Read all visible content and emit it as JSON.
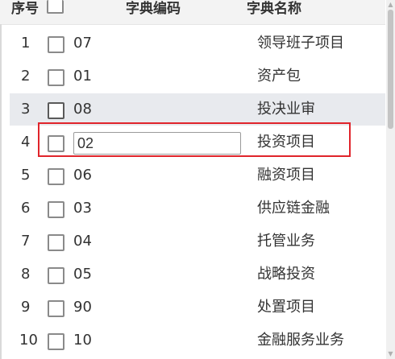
{
  "header": {
    "index_label": "序号",
    "code_label": "字典编码",
    "name_label": "字典名称"
  },
  "rows": [
    {
      "index": "1",
      "code": "07",
      "name": "领导班子项目",
      "highlighted": false,
      "editing": false
    },
    {
      "index": "2",
      "code": "01",
      "name": "资产包",
      "highlighted": false,
      "editing": false
    },
    {
      "index": "3",
      "code": "08",
      "name": "投决业审",
      "highlighted": true,
      "editing": false
    },
    {
      "index": "4",
      "code": "02",
      "name": "投资项目",
      "highlighted": false,
      "editing": true
    },
    {
      "index": "5",
      "code": "06",
      "name": "融资项目",
      "highlighted": false,
      "editing": false
    },
    {
      "index": "6",
      "code": "03",
      "name": "供应链金融",
      "highlighted": false,
      "editing": false
    },
    {
      "index": "7",
      "code": "04",
      "name": "托管业务",
      "highlighted": false,
      "editing": false
    },
    {
      "index": "8",
      "code": "05",
      "name": "战略投资",
      "highlighted": false,
      "editing": false
    },
    {
      "index": "9",
      "code": "90",
      "name": "处置项目",
      "highlighted": false,
      "editing": false
    },
    {
      "index": "10",
      "code": "10",
      "name": "金融服务业务",
      "highlighted": false,
      "editing": false
    }
  ],
  "colors": {
    "selection_outline": "#e0242b",
    "row_highlight": "#e8eaee",
    "header_bg": "#f3f3f3"
  }
}
